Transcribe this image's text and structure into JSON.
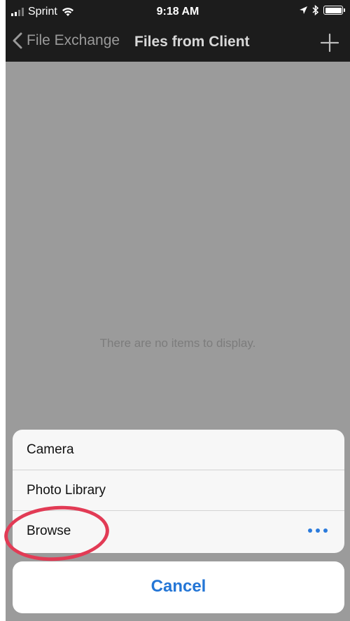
{
  "status_bar": {
    "carrier": "Sprint",
    "time": "9:18 AM",
    "icons": [
      "signal-icon",
      "wifi-icon",
      "location-icon",
      "bluetooth-icon",
      "battery-icon"
    ]
  },
  "nav": {
    "back_label": "File Exchange",
    "title": "Files from Client",
    "icons": [
      "chevron-left-icon",
      "plus-icon"
    ]
  },
  "content": {
    "empty_message": "There are no items to display."
  },
  "action_sheet": {
    "items": [
      {
        "label": "Camera"
      },
      {
        "label": "Photo Library"
      },
      {
        "label": "Browse"
      }
    ],
    "more_icon": "ellipsis-icon",
    "cancel_label": "Cancel"
  },
  "colors": {
    "accent": "#2476d6",
    "bar_background": "#1c1c1c",
    "dimmed_background": "#9b9b9b",
    "annotation": "#e23b55"
  }
}
